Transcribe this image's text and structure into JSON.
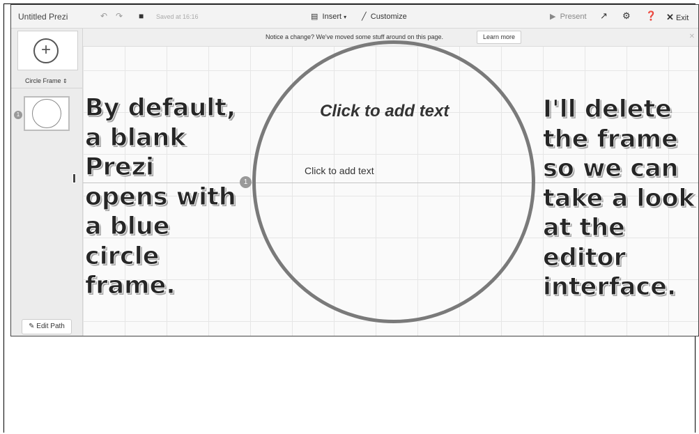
{
  "app": {
    "title": "Untitled Prezi",
    "saved_text": "Saved at 16:16"
  },
  "toolbar": {
    "insert_label": "Insert",
    "customize_label": "Customize",
    "present_label": "Present",
    "exit_label": "Exit"
  },
  "notice": {
    "text": "Notice a change? We've moved some stuff around on this page.",
    "learn_more": "Learn more"
  },
  "left_panel": {
    "frame_type": "Circle Frame",
    "thumbnail_number": "1",
    "edit_path_label": "Edit Path"
  },
  "canvas": {
    "frame_number": "1",
    "title_placeholder": "Click to add text",
    "body_placeholder": "Click to add text"
  },
  "callouts": {
    "left": [
      "By default,",
      "a blank",
      "Prezi",
      "opens with",
      "a blue",
      "circle",
      "frame."
    ],
    "right": [
      "I'll delete",
      "the frame",
      "so we can",
      "take a look",
      "at the",
      "editor",
      "interface."
    ]
  }
}
